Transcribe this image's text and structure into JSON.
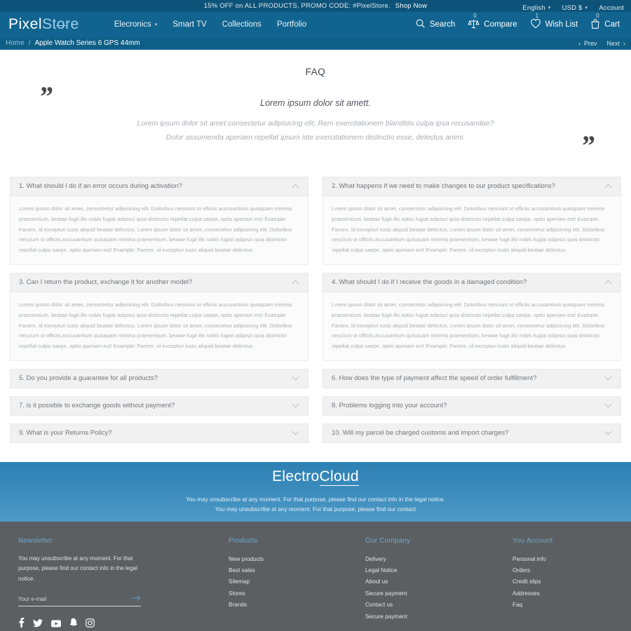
{
  "promo": {
    "text": "15% OFF on ALL PRODUCTS, PROMO CODE: #PixelStore.",
    "link": "Shop Now",
    "language": "English",
    "currency": "USD $",
    "account": "Account"
  },
  "header": {
    "logo_part1": "Pixel",
    "logo_part2_a": "St",
    "logo_part2_o": "o",
    "logo_part2_b": "re",
    "nav": [
      {
        "label": "Elecronics",
        "has_caret": true
      },
      {
        "label": "Smart TV",
        "has_caret": false
      },
      {
        "label": "Collections",
        "has_caret": false
      },
      {
        "label": "Portfolio",
        "has_caret": false
      }
    ],
    "actions": [
      {
        "label": "Search",
        "icon": "search-icon",
        "badge": ""
      },
      {
        "label": "Compare",
        "icon": "compare-icon",
        "badge": "0"
      },
      {
        "label": "Wish List",
        "icon": "heart-icon",
        "badge": "1"
      },
      {
        "label": "Cart",
        "icon": "cart-icon",
        "badge": "0"
      }
    ]
  },
  "breadcrumb": {
    "home": "Home",
    "separator": "/",
    "current": "Apple Watch Series 6 GPS 44mm",
    "prev": "Prev",
    "next": "Next"
  },
  "faq": {
    "title": "FAQ",
    "quote_lead": "Lorem ipsum dolor sit amett.",
    "quote_line1": "Lorem ipsum dolor sit amet consectetur adipisicing elit. Rem exercitationem blanditiis culpa ipsa recusandae?",
    "quote_line2": "Dolor assumenda aperiam repellat ipsum iste exercitationem distinctio esse, delectus animi.",
    "answer_body": "Lorem ipsum dolor sit amet, consectetur adipisicing elit. Doloribus nesciunt ut officiis accusantium quisquam minima praesentium, beatae fugit illo nobis fugiat adipisci quia distinctio repellat culpa saepe, optio aperiam est! Example: Facere, id excepturi iusto aliquid beatae delectus. Lorem ipsum dolor sit amet, consectetur adipisicing elit. Doloribus nesciunt ut officiis accusantium quisquam minima praesentium, beatae fugit illo nobis fugiat adipisci quia distinctio repellat culpa saepe, optio aperiam est! Example: Facere, id excepturi iusto aliquid beatae delectus.",
    "left_items": [
      {
        "question": "1. What should I do if an error occurs during activation?",
        "open": true
      },
      {
        "question": "3. Can I return the product, exchange it for another model?",
        "open": true
      },
      {
        "question": "5. Do you provide a guarantee for all products?",
        "open": false
      },
      {
        "question": "7. is it possible to exchange goods without payment?",
        "open": false
      },
      {
        "question": "9. What is your Returns Policy?",
        "open": false
      }
    ],
    "right_items": [
      {
        "question": "2. What happens if we need to make changes to our product specifications?",
        "open": true
      },
      {
        "question": "4. What should I do if I receive the goods in a damaged condition?",
        "open": true
      },
      {
        "question": "6. How does the type of payment affect the speed of order fulfillment?",
        "open": false
      },
      {
        "question": "8. Problems logging into your account?",
        "open": false
      },
      {
        "question": "10. Will my parcel be charged customs and import charges?",
        "open": false
      }
    ]
  },
  "newsletter_band": {
    "logo_a": "Electro",
    "logo_b": "Cloud",
    "note_line1": "You may unsubscribe at any moment. For that purpose, please find our contact info in the legal notice.",
    "note_line2": "You may unsubscribe at any moment. For that purpose, please find our contact"
  },
  "footer": {
    "newsletter": {
      "heading": "Newsletter",
      "text": "You may unsubscribe at any moment. For that purpose, please find our contact info in the legal notice.",
      "input_placeholder": "Your e-mail",
      "input_value": "",
      "socials": [
        "facebook-icon",
        "twitter-icon",
        "youtube-icon",
        "snapchat-icon",
        "instagram-icon"
      ]
    },
    "products": {
      "heading": "Products",
      "links": [
        "New products",
        "Best sales",
        "Sitemap",
        "Stores",
        "Brands"
      ]
    },
    "company": {
      "heading": "Our Company",
      "links": [
        "Delivery",
        "Legal Notice",
        "About us",
        "Secure payment",
        "Contact us",
        "Secure payment"
      ]
    },
    "account": {
      "heading": "You Account",
      "links": [
        "Personal info",
        "Orders",
        "Credit slips",
        "Addresses",
        "Faq"
      ]
    }
  },
  "colors": {
    "promo_bar": "#0d5379",
    "header": "#11648f",
    "breadcrumb": "#0f5e86",
    "accent_blue": "#6fa7cc",
    "footer_bg": "#5b5f61",
    "faq_header_bg": "#f1f1f1"
  }
}
